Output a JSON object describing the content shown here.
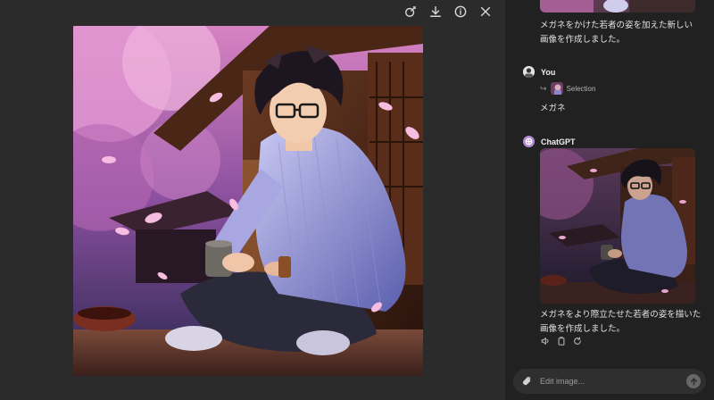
{
  "viewer": {
    "toolbar": [
      {
        "icon": "edit-brush-icon"
      },
      {
        "icon": "download-icon"
      },
      {
        "icon": "info-icon"
      },
      {
        "icon": "close-icon"
      }
    ],
    "image_subject": "anime-young-man-glasses-cherry-blossom-tea"
  },
  "chat": {
    "previous_message": "メガネをかけた若者の姿を加えた新しい画像を作成しました。",
    "user": {
      "author": "You",
      "selection_label": "Selection",
      "text": "メガネ"
    },
    "assistant": {
      "author": "ChatGPT",
      "text": "メガネをより際立たせた若者の姿を描いた画像を作成しました。",
      "actions": [
        "speaker-icon",
        "copy-icon",
        "regenerate-icon"
      ]
    },
    "input": {
      "placeholder": "Edit image..."
    }
  },
  "colors": {
    "panel_bg": "#212121",
    "viewer_bg": "#2b2b2b",
    "input_bg": "#2f2f2f",
    "bot_avatar": "#b38bd6"
  }
}
